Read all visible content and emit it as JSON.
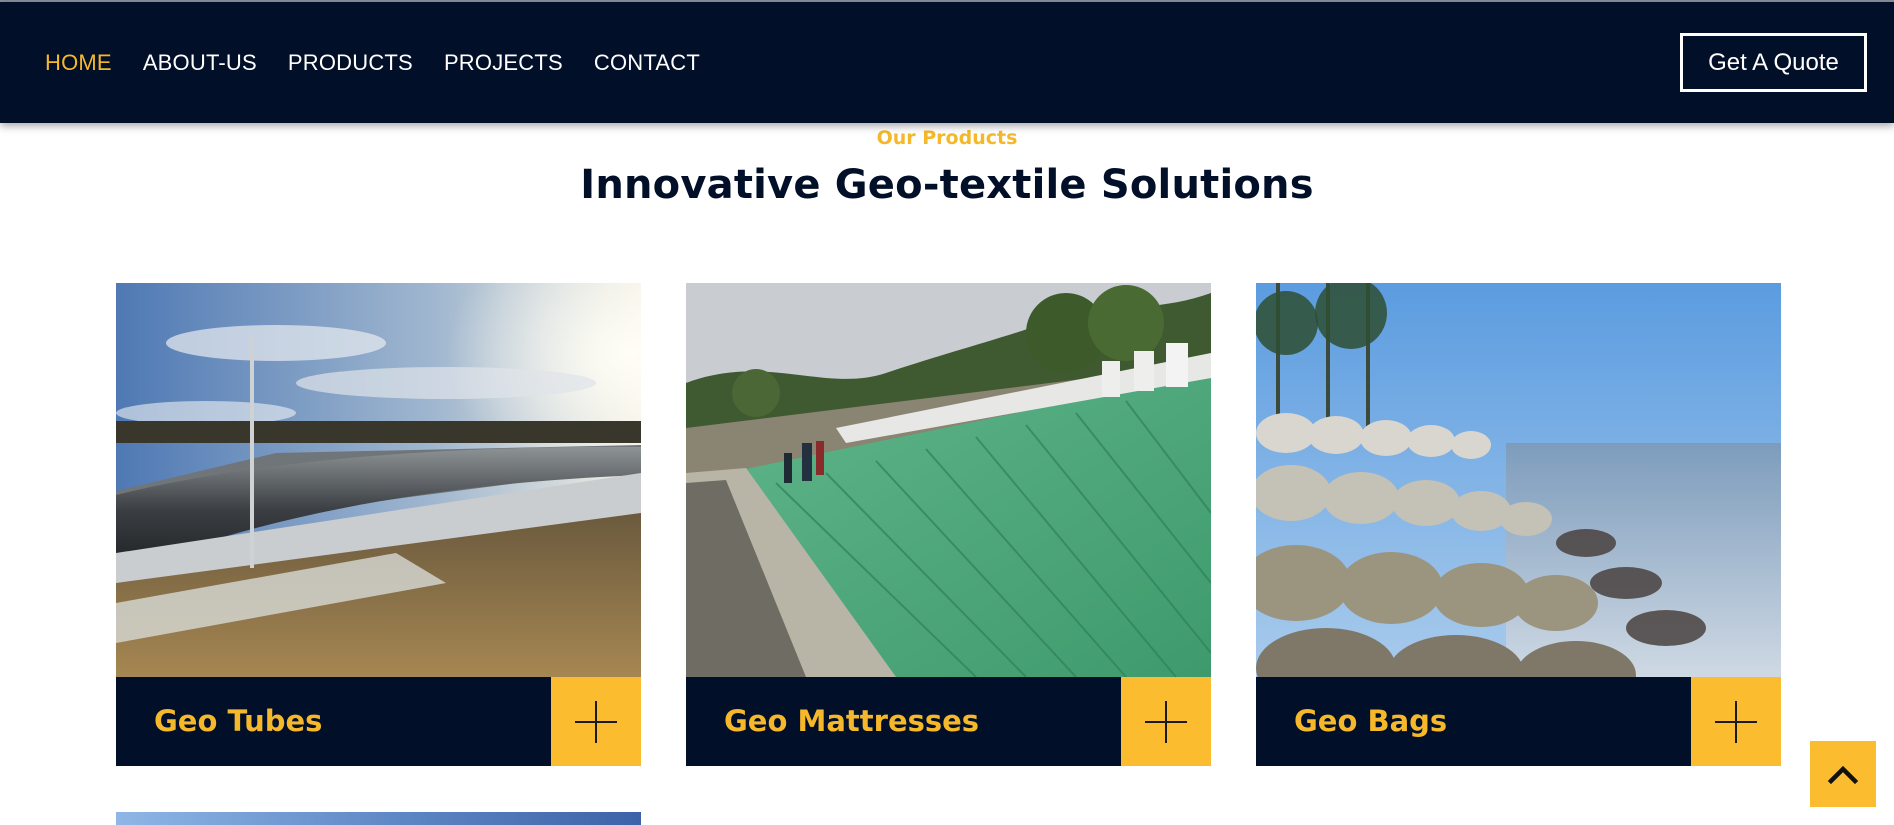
{
  "nav": {
    "links": [
      {
        "label": "HOME",
        "active": true
      },
      {
        "label": "ABOUT-US"
      },
      {
        "label": "PRODUCTS"
      },
      {
        "label": "PROJECTS"
      },
      {
        "label": "CONTACT"
      }
    ],
    "cta_label": "Get A Quote"
  },
  "section": {
    "eyebrow": "Our Products",
    "heading": "Innovative Geo-textile Solutions"
  },
  "products": [
    {
      "title": "Geo Tubes",
      "icon": "plus-icon"
    },
    {
      "title": "Geo Mattresses",
      "icon": "plus-icon"
    },
    {
      "title": "Geo Bags",
      "icon": "plus-icon"
    }
  ],
  "scroll_top_icon": "chevron-up-icon",
  "colors": {
    "navy": "#020f28",
    "accent": "#f5b82a",
    "accent_button": "#fbbd2f"
  }
}
